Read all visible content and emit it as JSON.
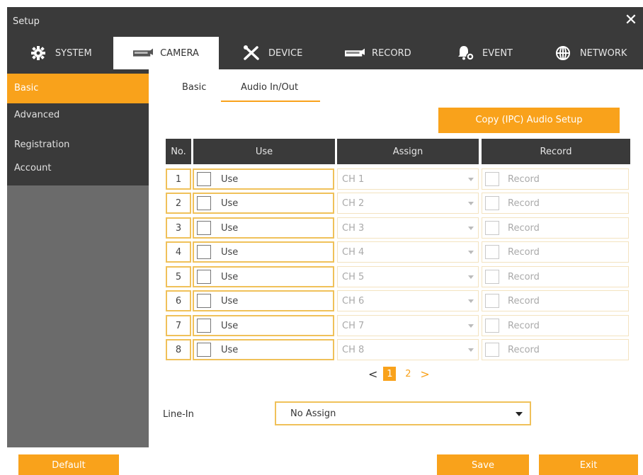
{
  "window": {
    "title": "Setup"
  },
  "tabs": [
    {
      "label": "SYSTEM",
      "icon": "gear-icon"
    },
    {
      "label": "CAMERA",
      "icon": "camera-icon"
    },
    {
      "label": "DEVICE",
      "icon": "tools-icon"
    },
    {
      "label": "RECORD",
      "icon": "record-icon"
    },
    {
      "label": "EVENT",
      "icon": "bell-icon"
    },
    {
      "label": "NETWORK",
      "icon": "globe-icon"
    }
  ],
  "active_tab": "CAMERA",
  "sidebar": {
    "items": [
      {
        "label": "Basic"
      },
      {
        "label": "Advanced"
      },
      {
        "label": "Registration"
      },
      {
        "label": "Account"
      }
    ],
    "active": "Basic"
  },
  "subtabs": [
    {
      "label": "Basic"
    },
    {
      "label": "Audio In/Out"
    }
  ],
  "active_subtab": "Audio In/Out",
  "copy_button": {
    "label": "Copy (IPC) Audio Setup"
  },
  "table": {
    "headers": {
      "no": "No.",
      "use": "Use",
      "assign": "Assign",
      "record": "Record"
    },
    "rows": [
      {
        "no": "1",
        "use": "Use",
        "assign": "CH 1",
        "record": "Record"
      },
      {
        "no": "2",
        "use": "Use",
        "assign": "CH 2",
        "record": "Record"
      },
      {
        "no": "3",
        "use": "Use",
        "assign": "CH 3",
        "record": "Record"
      },
      {
        "no": "4",
        "use": "Use",
        "assign": "CH 4",
        "record": "Record"
      },
      {
        "no": "5",
        "use": "Use",
        "assign": "CH 5",
        "record": "Record"
      },
      {
        "no": "6",
        "use": "Use",
        "assign": "CH 6",
        "record": "Record"
      },
      {
        "no": "7",
        "use": "Use",
        "assign": "CH 7",
        "record": "Record"
      },
      {
        "no": "8",
        "use": "Use",
        "assign": "CH 8",
        "record": "Record"
      }
    ]
  },
  "pager": {
    "prev": "<",
    "pages": [
      "1",
      "2"
    ],
    "current": "1",
    "next": ">"
  },
  "line_in": {
    "label": "Line-In",
    "value": "No Assign"
  },
  "footer": {
    "default_label": "Default",
    "save_label": "Save",
    "exit_label": "Exit"
  },
  "colors": {
    "accent": "#f9a21b",
    "dark": "#3a3a3a",
    "sidebar_bg": "#6b6b6b"
  }
}
